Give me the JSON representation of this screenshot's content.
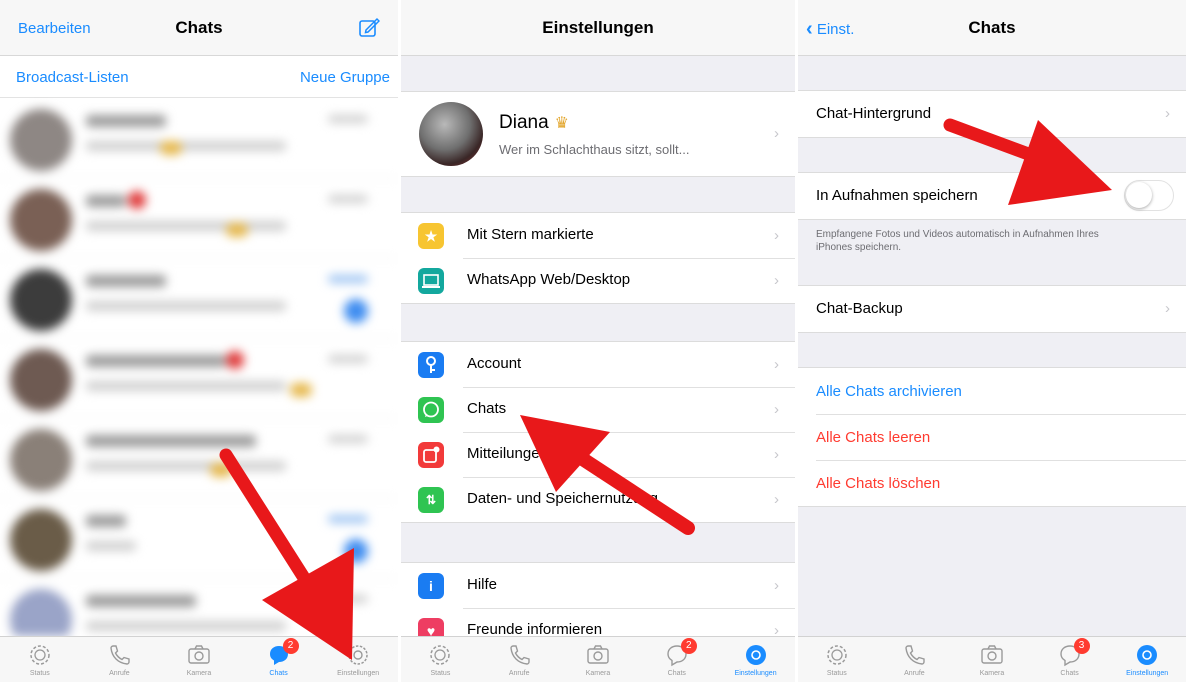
{
  "colors": {
    "ios_blue": "#1a8cff",
    "destructive_red": "#ff3b30",
    "annotation_red": "#e8181a"
  },
  "chats_screen": {
    "edit": "Bearbeiten",
    "title": "Chats",
    "broadcast": "Broadcast-Listen",
    "new_group": "Neue Gruppe",
    "tabs": [
      {
        "label": "Status",
        "icon": "status-icon"
      },
      {
        "label": "Anrufe",
        "icon": "phone-icon"
      },
      {
        "label": "Kamera",
        "icon": "camera-icon"
      },
      {
        "label": "Chats",
        "icon": "chats-icon",
        "badge": "2",
        "active": true
      },
      {
        "label": "Einstellungen",
        "icon": "settings-icon"
      }
    ]
  },
  "settings_screen": {
    "title": "Einstellungen",
    "profile": {
      "name": "Diana",
      "status": "Wer im Schlachthaus sitzt, sollt..."
    },
    "group1": [
      {
        "label": "Mit Stern markierte",
        "icon": "star-icon"
      },
      {
        "label": "WhatsApp Web/Desktop",
        "icon": "laptop-icon"
      }
    ],
    "group2": [
      {
        "label": "Account",
        "icon": "key-icon"
      },
      {
        "label": "Chats",
        "icon": "whatsapp-icon"
      },
      {
        "label": "Mitteilungen",
        "icon": "notification-icon"
      },
      {
        "label": "Daten- und Speichernutzung",
        "icon": "data-icon"
      }
    ],
    "group3": [
      {
        "label": "Hilfe",
        "icon": "info-icon"
      },
      {
        "label": "Freunde informieren",
        "icon": "heart-icon"
      }
    ],
    "tabs": [
      {
        "label": "Status"
      },
      {
        "label": "Anrufe"
      },
      {
        "label": "Kamera"
      },
      {
        "label": "Chats",
        "badge": "2"
      },
      {
        "label": "Einstellungen",
        "active": true
      }
    ]
  },
  "chat_settings_screen": {
    "back": "Einst.",
    "title": "Chats",
    "wallpaper": "Chat-Hintergrund",
    "save_to_camera_roll": "In Aufnahmen speichern",
    "save_toggle_on": false,
    "footnote": "Empfangene Fotos und Videos automatisch in Aufnahmen Ihres iPhones speichern.",
    "backup": "Chat-Backup",
    "archive_all": "Alle Chats archivieren",
    "clear_all": "Alle Chats leeren",
    "delete_all": "Alle Chats löschen",
    "tabs": [
      {
        "label": "Status"
      },
      {
        "label": "Anrufe"
      },
      {
        "label": "Kamera"
      },
      {
        "label": "Chats",
        "badge": "3"
      },
      {
        "label": "Einstellungen",
        "active": true
      }
    ]
  }
}
